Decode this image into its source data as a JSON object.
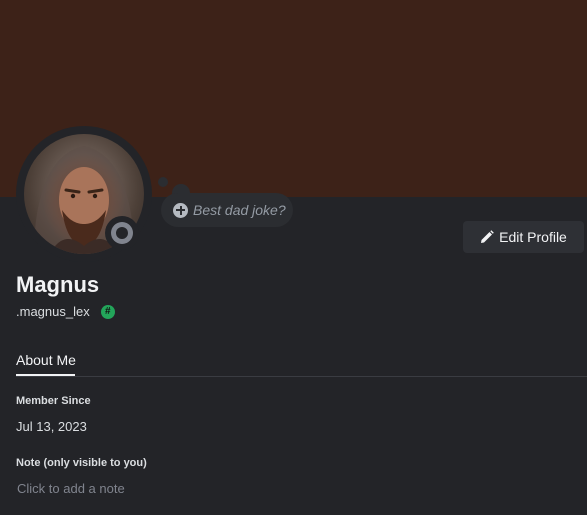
{
  "profile": {
    "display_name": "Magnus",
    "username": ".magnus_lex",
    "badge_icon": "hash-badge-icon",
    "badge_color": "#23a55a",
    "status_level": "offline"
  },
  "status_bubble": {
    "placeholder": "Best dad joke?",
    "icon": "plus-circle-icon"
  },
  "actions": {
    "edit_profile_label": "Edit Profile",
    "edit_icon": "pencil-icon"
  },
  "tabs": [
    {
      "label": "About Me",
      "active": true
    }
  ],
  "about": {
    "member_since_label": "Member Since",
    "member_since_value": "Jul 13, 2023",
    "note_label": "Note (only visible to you)",
    "note_placeholder": "Click to add a note"
  },
  "colors": {
    "banner": "#3d2218",
    "background": "#232428",
    "button": "#2e3035",
    "status_offline": "#80848e"
  }
}
